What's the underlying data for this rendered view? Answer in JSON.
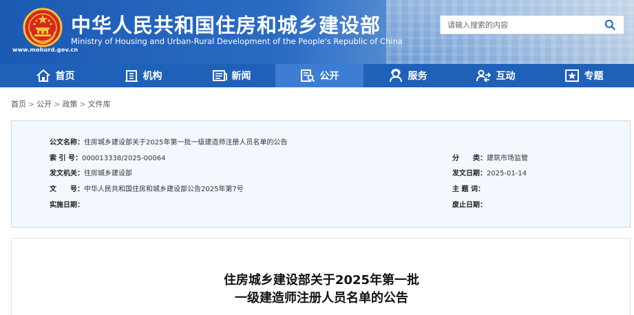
{
  "header": {
    "title": "中华人民共和国住房和城乡建设部",
    "subtitle": "Ministry of Housing and Urban-Rural Development of the People's Republic of China",
    "url": "www.mohurd.gov.cn",
    "emblem_icon": "national-emblem-icon",
    "search": {
      "placeholder": "请输入搜索的内容",
      "button_icon": "search-icon"
    }
  },
  "nav": {
    "items": [
      {
        "label": "首页",
        "icon": "home-icon"
      },
      {
        "label": "机构",
        "icon": "building-icon"
      },
      {
        "label": "新闻",
        "icon": "news-icon"
      },
      {
        "label": "公开",
        "icon": "document-icon",
        "active": true
      },
      {
        "label": "服务",
        "icon": "service-icon"
      },
      {
        "label": "互动",
        "icon": "interaction-icon"
      },
      {
        "label": "专题",
        "icon": "topic-icon"
      }
    ]
  },
  "breadcrumb": {
    "items": [
      "首页",
      "公开",
      "政策",
      "文件库"
    ],
    "separator": ">"
  },
  "meta": {
    "doc_name_label": "公文名称：",
    "doc_name": "住房城乡建设部关于2025年第一批一级建造师注册人员名单的公告",
    "index_label": "索 引 号：",
    "index": "000013338/2025-00064",
    "category_label": "分　　类：",
    "category": "建筑市场监管",
    "issuer_label": "发文机关：",
    "issuer": "住房城乡建设部",
    "date_label": "发文日期：",
    "date": "2025-01-14",
    "doc_no_label": "文　　号：",
    "doc_no": "中华人民共和国住房和城乡建设部公告2025年第7号",
    "subject_label": "主 题 词：",
    "subject": "",
    "effective_label": "实施日期：",
    "effective": "",
    "expiry_label": "废止日期：",
    "expiry": ""
  },
  "article": {
    "title_line1": "住房城乡建设部关于2025年第一批",
    "title_line2": "一级建造师注册人员名单的公告"
  },
  "colors": {
    "nav_bg": "#1f61b8",
    "nav_active": "#3d7ed2",
    "meta_bg": "#f2f8fd",
    "meta_border": "#c7dcee"
  }
}
